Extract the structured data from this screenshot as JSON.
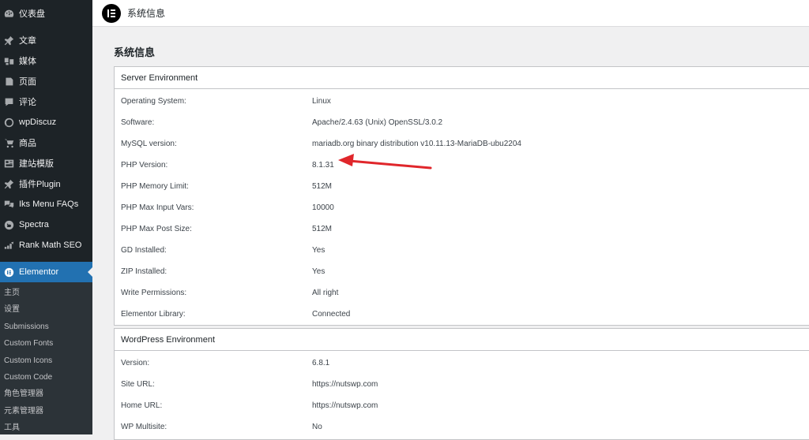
{
  "sidebar": {
    "items": [
      {
        "label": "仪表盘",
        "icon": "dashboard-icon"
      },
      {
        "label": "文章",
        "icon": "pin-icon"
      },
      {
        "label": "媒体",
        "icon": "media-icon"
      },
      {
        "label": "页面",
        "icon": "page-icon"
      },
      {
        "label": "评论",
        "icon": "comment-icon"
      },
      {
        "label": "wpDiscuz",
        "icon": "wpdiscuz-icon"
      },
      {
        "label": "商品",
        "icon": "cart-icon"
      },
      {
        "label": "建站模版",
        "icon": "template-icon"
      },
      {
        "label": "插件Plugin",
        "icon": "pin-icon"
      },
      {
        "label": "Iks Menu FAQs",
        "icon": "faq-icon"
      },
      {
        "label": "Spectra",
        "icon": "spectra-icon"
      },
      {
        "label": "Rank Math SEO",
        "icon": "rankmath-icon"
      },
      {
        "label": "Elementor",
        "icon": "elementor-icon"
      }
    ],
    "submenu": [
      "主页",
      "设置",
      "Submissions",
      "Custom Fonts",
      "Custom Icons",
      "Custom Code",
      "角色管理器",
      "元素管理器",
      "工具"
    ]
  },
  "topbar": {
    "title": "系统信息"
  },
  "page": {
    "heading": "系统信息"
  },
  "server_env": {
    "title": "Server Environment",
    "rows": [
      {
        "k": "Operating System:",
        "v": "Linux"
      },
      {
        "k": "Software:",
        "v": "Apache/2.4.63 (Unix) OpenSSL/3.0.2"
      },
      {
        "k": "MySQL version:",
        "v": "mariadb.org binary distribution v10.11.13-MariaDB-ubu2204"
      },
      {
        "k": "PHP Version:",
        "v": "8.1.31"
      },
      {
        "k": "PHP Memory Limit:",
        "v": "512M"
      },
      {
        "k": "PHP Max Input Vars:",
        "v": "10000"
      },
      {
        "k": "PHP Max Post Size:",
        "v": "512M"
      },
      {
        "k": "GD Installed:",
        "v": "Yes"
      },
      {
        "k": "ZIP Installed:",
        "v": "Yes"
      },
      {
        "k": "Write Permissions:",
        "v": "All right"
      },
      {
        "k": "Elementor Library:",
        "v": "Connected"
      }
    ]
  },
  "wp_env": {
    "title": "WordPress Environment",
    "rows": [
      {
        "k": "Version:",
        "v": "6.8.1"
      },
      {
        "k": "Site URL:",
        "v": "https://nutswp.com"
      },
      {
        "k": "Home URL:",
        "v": "https://nutswp.com"
      },
      {
        "k": "WP Multisite:",
        "v": "No"
      }
    ]
  },
  "colors": {
    "sidebar": "#1d2327",
    "active": "#2271b1",
    "arrow": "#e0262b"
  }
}
